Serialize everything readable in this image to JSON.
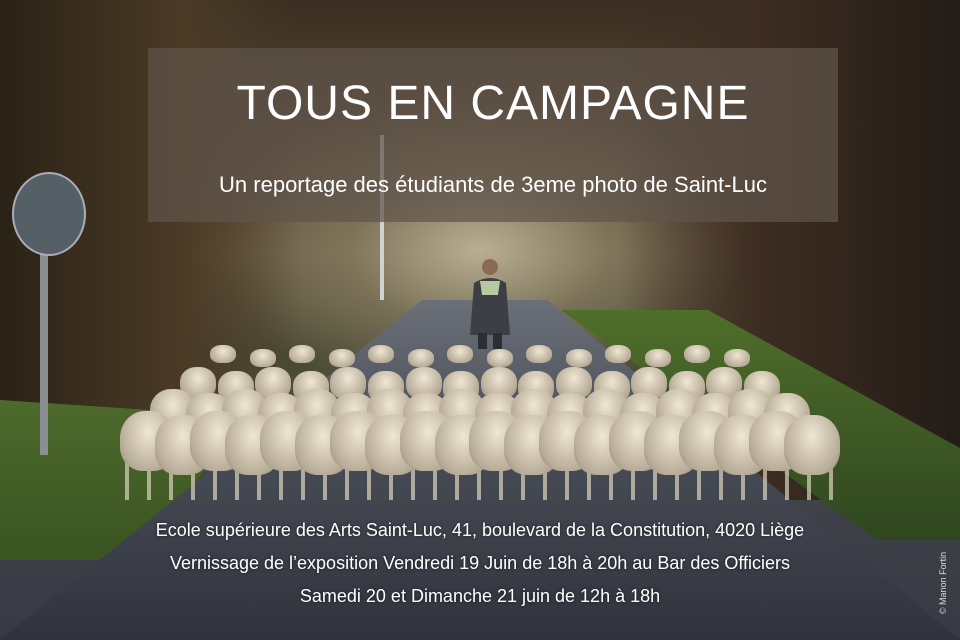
{
  "poster": {
    "title": "TOUS EN CAMPAGNE",
    "subtitle": "Un reportage des étudiants de 3eme photo de Saint-Luc",
    "info": [
      "Ecole supérieure des Arts Saint-Luc, 41, boulevard de la Constitution, 4020 Liège",
      "Vernissage de l’exposition Vendredi 19 Juin de 18h à 20h au Bar des Officiers",
      "Samedi 20 et Dimanche 21 juin de 12h à 18h"
    ],
    "credit": "© Manon Fortin"
  }
}
